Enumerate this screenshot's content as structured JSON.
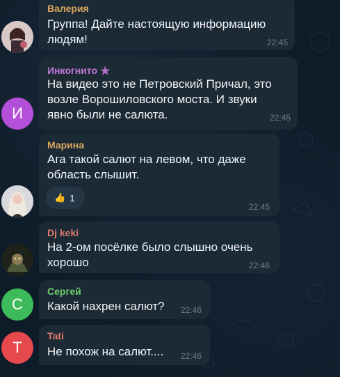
{
  "messages": [
    {
      "sender": "Валерия",
      "sender_color": "#d9a55c",
      "text": "Группа! Дайте настоящую информацию\nлюдям!",
      "time": "22:45",
      "avatar": "photo-woman-icon"
    },
    {
      "sender": "Инкогнито",
      "sender_color": "#c078d8",
      "text": "На видео это не Петровский Причал, это\nвозле Ворошиловского моста. И звуки\nявно были не салюта.",
      "time": "22:45",
      "avatar_letter": "И",
      "avatar_color": "#b34fd9"
    },
    {
      "sender": "Марина",
      "sender_color": "#d9a55c",
      "text": "Ага такой салют на левом, что даже\nобласть слышит.",
      "time": "22:45",
      "reaction_emoji": "👍",
      "reaction_count": "1",
      "avatar": "photo-blonde-icon"
    },
    {
      "sender": "Dj keki",
      "sender_color": "#e07a6a",
      "text": "На 2-ом посёлке было слышно очень\nхорошо",
      "time": "22:46",
      "avatar": "photo-character-icon"
    },
    {
      "sender": "Сергей",
      "sender_color": "#6fcf6f",
      "text": "Какой нахрен салют?",
      "time": "22:46",
      "avatar_letter": "С",
      "avatar_color": "#3dbb5a"
    },
    {
      "sender": "Tati",
      "sender_color": "#e07a6a",
      "text": "Не похож на салют....",
      "time": "22:46",
      "avatar_letter": "T",
      "avatar_color": "#e5484d"
    }
  ]
}
